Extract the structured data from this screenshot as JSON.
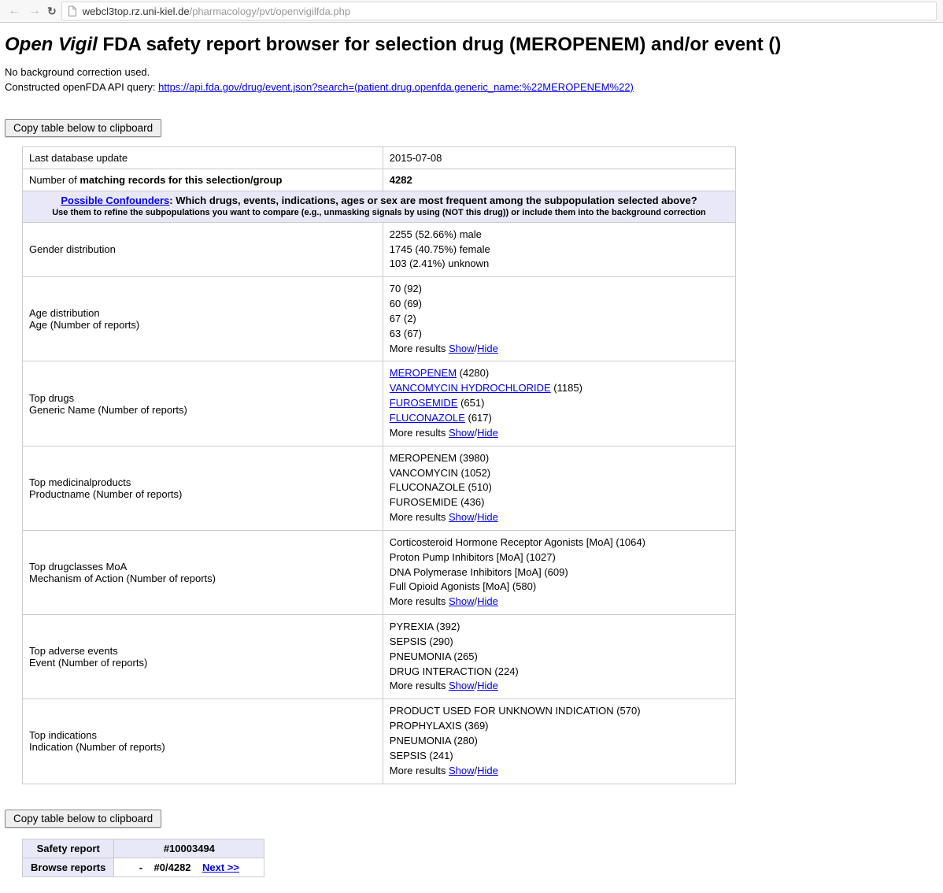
{
  "browser": {
    "url_host": "webcl3top.rz.uni-kiel.de",
    "url_path": "/pharmacology/pvt/openvigilfda.php"
  },
  "heading": {
    "prefix": "Open Vigil",
    "rest": " FDA safety report browser for selection drug (MEROPENEM) and/or event ()"
  },
  "intro": {
    "line1": "No background correction used.",
    "line2_prefix": "Constructed openFDA API query: ",
    "api_link": "https://api.fda.gov/drug/event.json?search=(patient.drug.openfda.generic_name:%22MEROPENEM%22)"
  },
  "copy_button": "Copy table below to clipboard",
  "summary": {
    "last_update_label": "Last database update",
    "last_update_value": "2015-07-08",
    "matching_label_prefix": "Number of ",
    "matching_label_bold": "matching records for this selection/group",
    "matching_value": "4282"
  },
  "confounders_header": {
    "link": "Possible Confounders",
    "after": ": Which drugs, events, indications, ages or sex are most frequent among the subpopulation selected above?",
    "sub": "Use them to refine the subpopulations you want to compare (e.g., unmasking signals by using (NOT this drug)) or include them into the background correction"
  },
  "more_results": "More results ",
  "show": "Show",
  "hide": "Hide",
  "rows": {
    "gender": {
      "label": "Gender distribution",
      "lines": [
        "2255 (52.66%) male",
        "1745 (40.75%) female",
        "103 (2.41%) unknown"
      ],
      "has_more": false
    },
    "age": {
      "label_l1": "Age distribution",
      "label_l2": "Age (Number of reports)",
      "lines": [
        "70 (92)",
        "60 (69)",
        "67 (2)",
        "63 (67)"
      ],
      "has_more": true
    },
    "drugs": {
      "label_l1": "Top drugs",
      "label_l2": "Generic Name (Number of reports)",
      "items": [
        {
          "name": "MEROPENEM",
          "count": "(4280)",
          "link": true
        },
        {
          "name": "VANCOMYCIN HYDROCHLORIDE",
          "count": "(1185)",
          "link": true
        },
        {
          "name": "FUROSEMIDE",
          "count": "(651)",
          "link": true
        },
        {
          "name": "FLUCONAZOLE",
          "count": "(617)",
          "link": true
        }
      ],
      "has_more": true
    },
    "medprod": {
      "label_l1": "Top medicinalproducts",
      "label_l2": "Productname (Number of reports)",
      "lines": [
        "MEROPENEM (3980)",
        "VANCOMYCIN (1052)",
        "FLUCONAZOLE (510)",
        "FUROSEMIDE (436)"
      ],
      "has_more": true
    },
    "drugclass": {
      "label_l1": "Top drugclasses MoA",
      "label_l2": "Mechanism of Action (Number of reports)",
      "lines": [
        "Corticosteroid Hormone Receptor Agonists [MoA] (1064)",
        "Proton Pump Inhibitors [MoA] (1027)",
        "DNA Polymerase Inhibitors [MoA] (609)",
        "Full Opioid Agonists [MoA] (580)"
      ],
      "has_more": true
    },
    "events": {
      "label_l1": "Top adverse events",
      "label_l2": "Event (Number of reports)",
      "lines": [
        "PYREXIA (392)",
        "SEPSIS (290)",
        "PNEUMONIA (265)",
        "DRUG INTERACTION (224)"
      ],
      "has_more": true
    },
    "indications": {
      "label_l1": "Top indications",
      "label_l2": "Indication (Number of reports)",
      "lines": [
        "PRODUCT USED FOR UNKNOWN INDICATION (570)",
        "PROPHYLAXIS (369)",
        "PNEUMONIA (280)",
        "SEPSIS (241)"
      ],
      "has_more": true
    }
  },
  "safety_table": {
    "row1_label": "Safety report",
    "row1_value": "#10003494",
    "row2_label": "Browse reports",
    "row2_dash": "-",
    "row2_pos": "#0/4282",
    "row2_next": "Next >>"
  }
}
